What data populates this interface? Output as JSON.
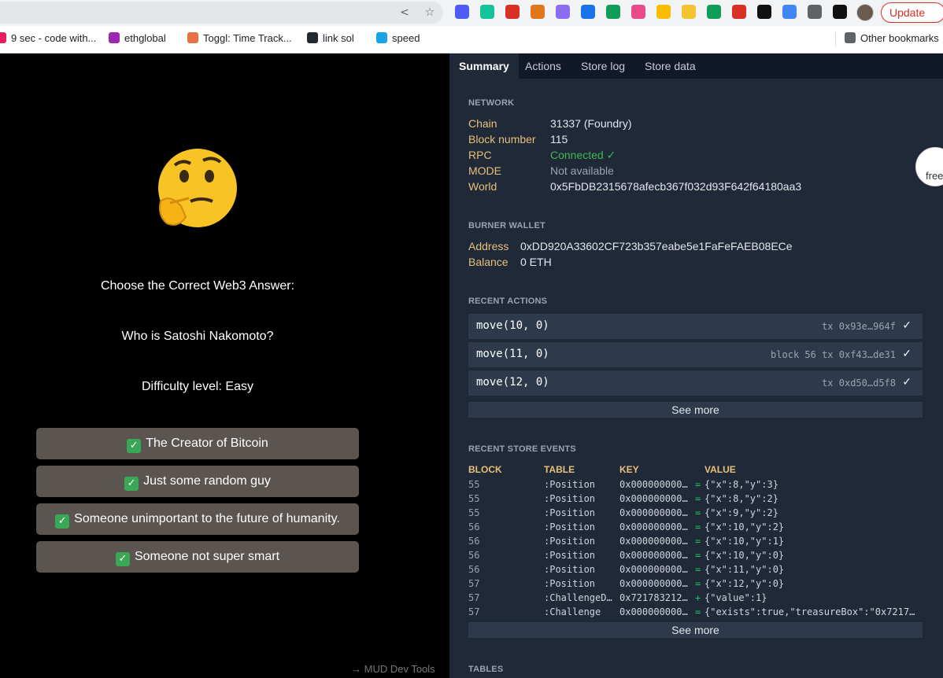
{
  "browser": {
    "update_label": "Update",
    "extension_colors": [
      "#4c5cf5",
      "#15c39a",
      "#d93025",
      "#e2761b",
      "#8a6df1",
      "#1a73e8",
      "#0f9d58",
      "#e84b8a",
      "#fbbc04",
      "#f4c430",
      "#0f9d58",
      "#d93025",
      "#111111",
      "#4285f4",
      "#5f6368",
      "#111111"
    ]
  },
  "bookmarks": [
    {
      "label": "9 sec - code with...",
      "color": "#e91e63"
    },
    {
      "label": "ethglobal",
      "color": "#9c27b0"
    },
    {
      "label": "Toggl: Time Track...",
      "color": "#e57442"
    },
    {
      "label": "link sol",
      "color": "#24292f"
    },
    {
      "label": "speed",
      "color": "#1aa3e8"
    }
  ],
  "other_bookmarks": "Other bookmarks",
  "game": {
    "prompt": "Choose the Correct Web3 Answer:",
    "question": "Who is Satoshi Nakomoto?",
    "difficulty": "Difficulty level: Easy",
    "check_glyph": "✓",
    "answers": [
      "The Creator of Bitcoin",
      "Just some random guy",
      "Someone unimportant to the future of humanity.",
      "Someone not super smart"
    ],
    "devtools_link": "→ MUD Dev Tools"
  },
  "devtools": {
    "tabs": [
      "Summary",
      "Actions",
      "Store log",
      "Store data"
    ],
    "network": {
      "heading": "NETWORK",
      "rows": [
        {
          "key": "Chain",
          "value": "31337 (Foundry)"
        },
        {
          "key": "Block number",
          "value": "115"
        },
        {
          "key": "RPC",
          "value": "Connected ✓"
        },
        {
          "key": "MODE",
          "value": "Not available"
        },
        {
          "key": "World",
          "value": "0x5FbDB2315678afecb367f032d93F642f64180aa3"
        }
      ]
    },
    "burner": {
      "heading": "BURNER WALLET",
      "rows": [
        {
          "key": "Address",
          "value": "0xDD920A33602CF723b357eabe5e1FaFeFAEB08ECe"
        },
        {
          "key": "Balance",
          "value": "0 ETH"
        }
      ]
    },
    "recent_actions": {
      "heading": "RECENT ACTIONS",
      "items": [
        {
          "fn": "move(10, 0)",
          "meta": "tx 0x93e…964f",
          "status": "✓"
        },
        {
          "fn": "move(11, 0)",
          "meta": "block 56 tx 0xf43…de31",
          "status": "✓"
        },
        {
          "fn": "move(12, 0)",
          "meta": "tx 0xd50…d5f8",
          "status": "✓"
        }
      ],
      "see_more": "See more"
    },
    "store_events": {
      "heading": "RECENT STORE EVENTS",
      "columns": [
        "BLOCK",
        "TABLE",
        "KEY",
        "VALUE"
      ],
      "rows": [
        {
          "block": "55",
          "table": ":Position",
          "key": "0x000000000…",
          "op": "=",
          "value": "{\"x\":8,\"y\":3}"
        },
        {
          "block": "55",
          "table": ":Position",
          "key": "0x000000000…",
          "op": "=",
          "value": "{\"x\":8,\"y\":2}"
        },
        {
          "block": "55",
          "table": ":Position",
          "key": "0x000000000…",
          "op": "=",
          "value": "{\"x\":9,\"y\":2}"
        },
        {
          "block": "56",
          "table": ":Position",
          "key": "0x000000000…",
          "op": "=",
          "value": "{\"x\":10,\"y\":2}"
        },
        {
          "block": "56",
          "table": ":Position",
          "key": "0x000000000…",
          "op": "=",
          "value": "{\"x\":10,\"y\":1}"
        },
        {
          "block": "56",
          "table": ":Position",
          "key": "0x000000000…",
          "op": "=",
          "value": "{\"x\":10,\"y\":0}"
        },
        {
          "block": "56",
          "table": ":Position",
          "key": "0x000000000…",
          "op": "=",
          "value": "{\"x\":11,\"y\":0}"
        },
        {
          "block": "57",
          "table": ":Position",
          "key": "0x000000000…",
          "op": "=",
          "value": "{\"x\":12,\"y\":0}"
        },
        {
          "block": "57",
          "table": ":ChallengeD…",
          "key": "0x721783212…",
          "op": "+",
          "value": "{\"value\":1}"
        },
        {
          "block": "57",
          "table": ":Challenge",
          "key": "0x000000000…",
          "op": "=",
          "value": "{\"exists\":true,\"treasureBox\":\"0x7217…"
        }
      ],
      "see_more": "See more"
    },
    "tables_heading": "TABLES"
  },
  "side_badge_text": "free"
}
